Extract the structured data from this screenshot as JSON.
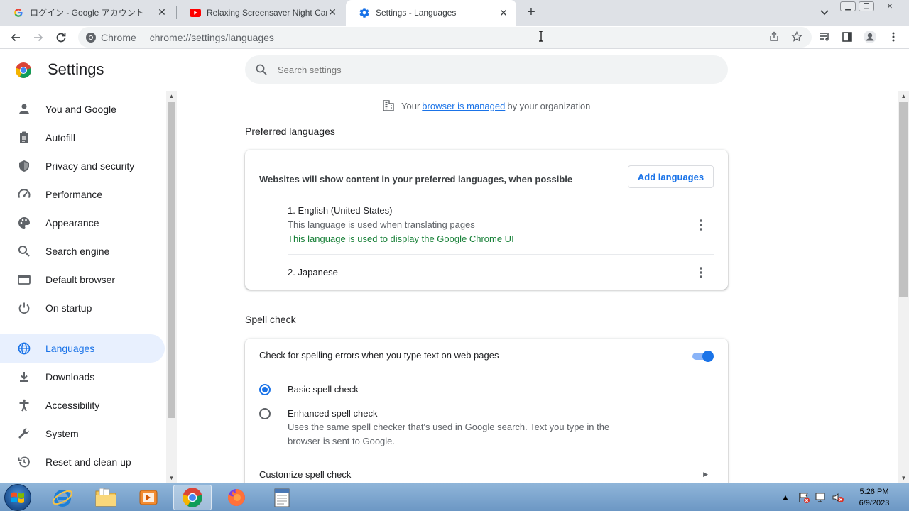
{
  "tabs": [
    {
      "title": "ログイン - Google アカウント",
      "icon": "google-g-icon"
    },
    {
      "title": "Relaxing Screensaver Night Car S",
      "icon": "youtube-icon"
    },
    {
      "title": "Settings - Languages",
      "icon": "settings-gear-icon"
    }
  ],
  "toolbar": {
    "site_chip": "Chrome",
    "url": "chrome://settings/languages"
  },
  "settings": {
    "title": "Settings",
    "search_placeholder": "Search settings"
  },
  "sidebar": {
    "items": [
      {
        "label": "You and Google",
        "icon": "person-icon"
      },
      {
        "label": "Autofill",
        "icon": "clipboard-icon"
      },
      {
        "label": "Privacy and security",
        "icon": "shield-icon"
      },
      {
        "label": "Performance",
        "icon": "speedometer-icon"
      },
      {
        "label": "Appearance",
        "icon": "palette-icon"
      },
      {
        "label": "Search engine",
        "icon": "search-icon"
      },
      {
        "label": "Default browser",
        "icon": "browser-window-icon"
      },
      {
        "label": "On startup",
        "icon": "power-icon"
      },
      {
        "label": "Languages",
        "icon": "globe-icon",
        "active": true
      },
      {
        "label": "Downloads",
        "icon": "download-icon"
      },
      {
        "label": "Accessibility",
        "icon": "accessibility-icon"
      },
      {
        "label": "System",
        "icon": "wrench-icon"
      },
      {
        "label": "Reset and clean up",
        "icon": "restore-icon"
      }
    ]
  },
  "managed": {
    "prefix": "Your",
    "link": "browser is managed",
    "suffix": "by your organization"
  },
  "preferred_languages": {
    "title": "Preferred languages",
    "description": "Websites will show content in your preferred languages, when possible",
    "add_button": "Add languages",
    "languages": [
      {
        "name": "1. English (United States)",
        "note": "This language is used when translating pages",
        "ui_note": "This language is used to display the Google Chrome UI"
      },
      {
        "name": "2. Japanese"
      }
    ]
  },
  "spell_check": {
    "title": "Spell check",
    "toggle_label": "Check for spelling errors when you type text on web pages",
    "toggle_on": true,
    "basic_label": "Basic spell check",
    "enhanced_label": "Enhanced spell check",
    "enhanced_desc": "Uses the same spell checker that's used in Google search. Text you type in the browser is sent to Google.",
    "selected": "basic",
    "customize_label": "Customize spell check"
  },
  "taskbar": {
    "apps": [
      "internet-explorer-icon",
      "file-explorer-icon",
      "media-player-icon",
      "chrome-icon",
      "firefox-icon",
      "notepad-icon"
    ],
    "time": "5:26 PM",
    "date": "6/9/2023"
  },
  "colors": {
    "accent": "#1a73e8",
    "active_nav_bg": "#e8f0fe",
    "green_note": "#188038"
  }
}
